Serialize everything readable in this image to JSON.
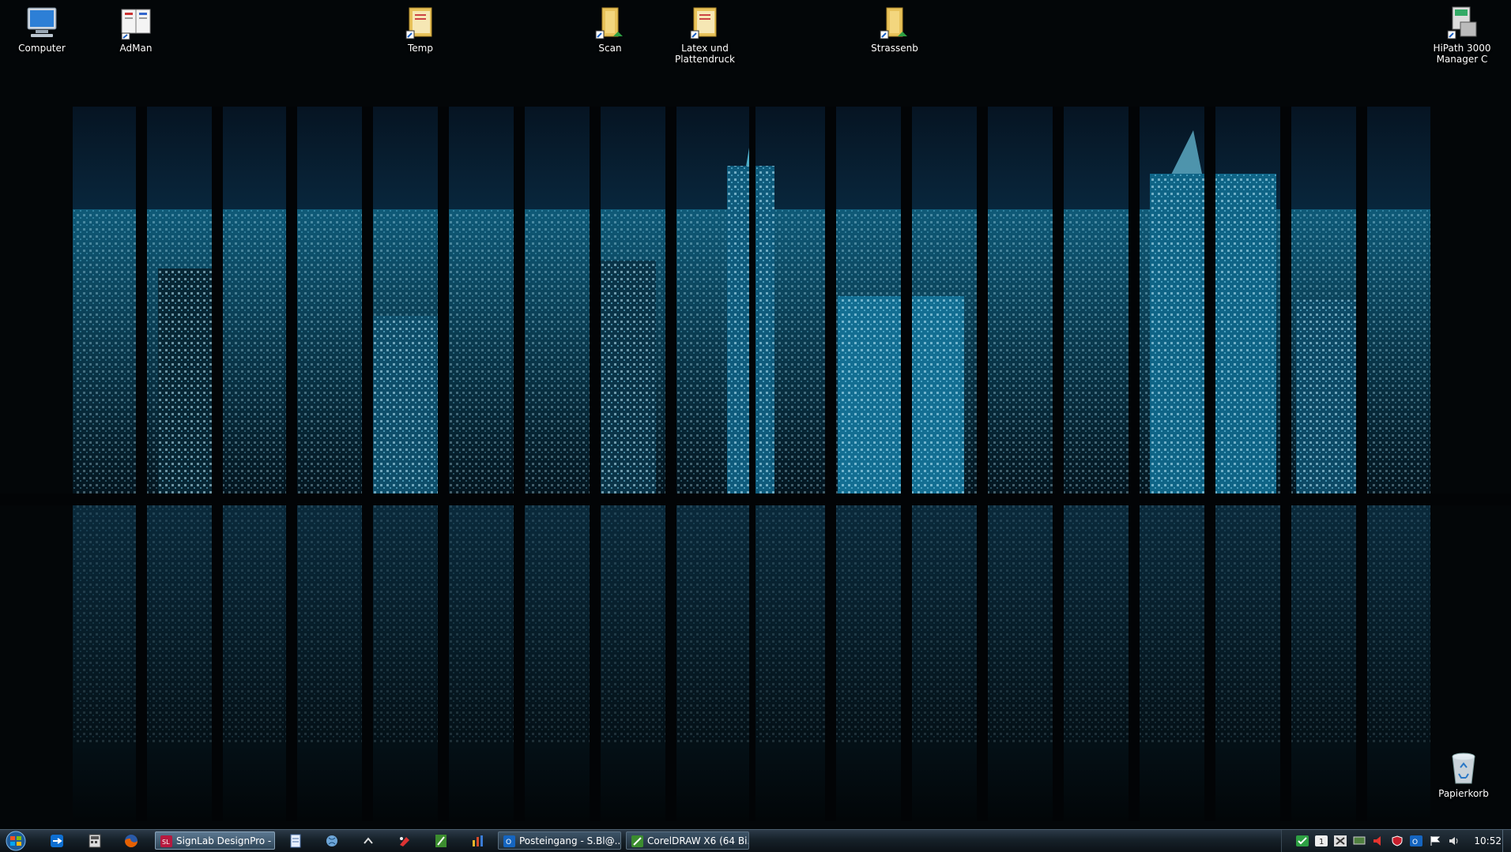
{
  "desktop": {
    "icons": [
      {
        "id": "computer",
        "label": "Computer",
        "icon": "computer-icon"
      },
      {
        "id": "adman",
        "label": "AdMan",
        "icon": "book-icon"
      },
      {
        "id": "temp",
        "label": "Temp",
        "icon": "folder-shortcut-icon"
      },
      {
        "id": "scan",
        "label": "Scan",
        "icon": "folder-shortcut-icon"
      },
      {
        "id": "latex",
        "label": "Latex und Plattendruck",
        "icon": "folder-shortcut-icon"
      },
      {
        "id": "strassenb",
        "label": "Strassenb",
        "icon": "folder-shortcut-icon"
      },
      {
        "id": "hipath",
        "label": "HiPath 3000 Manager C",
        "icon": "network-icon"
      },
      {
        "id": "papierkorb",
        "label": "Papierkorb",
        "icon": "recycle-bin-icon"
      }
    ]
  },
  "taskbar": {
    "start_icon": "windows-start-icon",
    "quick_launch": [
      "teamviewer-icon",
      "calculator-icon",
      "firefox-icon"
    ],
    "tasks": [
      {
        "label": "SignLab DesignPro - ...",
        "icon": "signlab-icon",
        "active": true
      },
      {
        "label": "Posteingang - S.Bl@...",
        "icon": "outlook-icon",
        "active": false
      },
      {
        "label": "CorelDRAW X6 (64 Bi...",
        "icon": "coreldraw-icon",
        "active": false
      }
    ],
    "pinned": [
      "notepad-icon",
      "globe-icon",
      "chevron-up-icon",
      "tool-icon",
      "coreldraw-icon",
      "chart-icon"
    ],
    "tray_icons": [
      "check-icon",
      "info-icon",
      "network-icon",
      "monitor-icon",
      "speaker-icon",
      "shield-icon",
      "outlook-icon",
      "flag-icon",
      "volume-icon"
    ],
    "clock": "10:52"
  },
  "colors": {
    "glass": "#1aa7c9",
    "accent": "#3a8fc0"
  }
}
